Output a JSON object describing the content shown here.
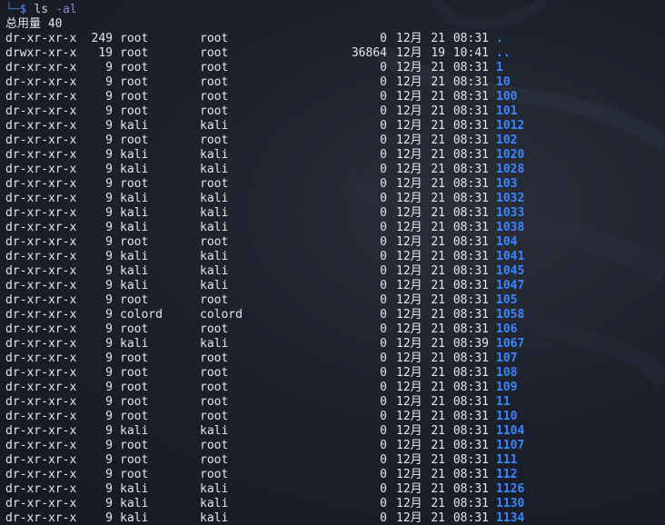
{
  "prompt": {
    "corner": "└─",
    "dollar": "$",
    "command": "ls",
    "argument": "-al"
  },
  "total_line": "总用量 40",
  "entries": [
    {
      "perm": "dr-xr-xr-x",
      "links": "249",
      "owner": "root",
      "group": "root",
      "size": "0",
      "month": "12月",
      "day": "21",
      "time": "08:31",
      "name": "."
    },
    {
      "perm": "drwxr-xr-x",
      "links": "19",
      "owner": "root",
      "group": "root",
      "size": "36864",
      "month": "12月",
      "day": "19",
      "time": "10:41",
      "name": ".."
    },
    {
      "perm": "dr-xr-xr-x",
      "links": "9",
      "owner": "root",
      "group": "root",
      "size": "0",
      "month": "12月",
      "day": "21",
      "time": "08:31",
      "name": "1"
    },
    {
      "perm": "dr-xr-xr-x",
      "links": "9",
      "owner": "root",
      "group": "root",
      "size": "0",
      "month": "12月",
      "day": "21",
      "time": "08:31",
      "name": "10"
    },
    {
      "perm": "dr-xr-xr-x",
      "links": "9",
      "owner": "root",
      "group": "root",
      "size": "0",
      "month": "12月",
      "day": "21",
      "time": "08:31",
      "name": "100"
    },
    {
      "perm": "dr-xr-xr-x",
      "links": "9",
      "owner": "root",
      "group": "root",
      "size": "0",
      "month": "12月",
      "day": "21",
      "time": "08:31",
      "name": "101"
    },
    {
      "perm": "dr-xr-xr-x",
      "links": "9",
      "owner": "kali",
      "group": "kali",
      "size": "0",
      "month": "12月",
      "day": "21",
      "time": "08:31",
      "name": "1012"
    },
    {
      "perm": "dr-xr-xr-x",
      "links": "9",
      "owner": "root",
      "group": "root",
      "size": "0",
      "month": "12月",
      "day": "21",
      "time": "08:31",
      "name": "102"
    },
    {
      "perm": "dr-xr-xr-x",
      "links": "9",
      "owner": "kali",
      "group": "kali",
      "size": "0",
      "month": "12月",
      "day": "21",
      "time": "08:31",
      "name": "1020"
    },
    {
      "perm": "dr-xr-xr-x",
      "links": "9",
      "owner": "kali",
      "group": "kali",
      "size": "0",
      "month": "12月",
      "day": "21",
      "time": "08:31",
      "name": "1028"
    },
    {
      "perm": "dr-xr-xr-x",
      "links": "9",
      "owner": "root",
      "group": "root",
      "size": "0",
      "month": "12月",
      "day": "21",
      "time": "08:31",
      "name": "103"
    },
    {
      "perm": "dr-xr-xr-x",
      "links": "9",
      "owner": "kali",
      "group": "kali",
      "size": "0",
      "month": "12月",
      "day": "21",
      "time": "08:31",
      "name": "1032"
    },
    {
      "perm": "dr-xr-xr-x",
      "links": "9",
      "owner": "kali",
      "group": "kali",
      "size": "0",
      "month": "12月",
      "day": "21",
      "time": "08:31",
      "name": "1033"
    },
    {
      "perm": "dr-xr-xr-x",
      "links": "9",
      "owner": "kali",
      "group": "kali",
      "size": "0",
      "month": "12月",
      "day": "21",
      "time": "08:31",
      "name": "1038"
    },
    {
      "perm": "dr-xr-xr-x",
      "links": "9",
      "owner": "root",
      "group": "root",
      "size": "0",
      "month": "12月",
      "day": "21",
      "time": "08:31",
      "name": "104"
    },
    {
      "perm": "dr-xr-xr-x",
      "links": "9",
      "owner": "kali",
      "group": "kali",
      "size": "0",
      "month": "12月",
      "day": "21",
      "time": "08:31",
      "name": "1041"
    },
    {
      "perm": "dr-xr-xr-x",
      "links": "9",
      "owner": "kali",
      "group": "kali",
      "size": "0",
      "month": "12月",
      "day": "21",
      "time": "08:31",
      "name": "1045"
    },
    {
      "perm": "dr-xr-xr-x",
      "links": "9",
      "owner": "kali",
      "group": "kali",
      "size": "0",
      "month": "12月",
      "day": "21",
      "time": "08:31",
      "name": "1047"
    },
    {
      "perm": "dr-xr-xr-x",
      "links": "9",
      "owner": "root",
      "group": "root",
      "size": "0",
      "month": "12月",
      "day": "21",
      "time": "08:31",
      "name": "105"
    },
    {
      "perm": "dr-xr-xr-x",
      "links": "9",
      "owner": "colord",
      "group": "colord",
      "size": "0",
      "month": "12月",
      "day": "21",
      "time": "08:31",
      "name": "1058"
    },
    {
      "perm": "dr-xr-xr-x",
      "links": "9",
      "owner": "root",
      "group": "root",
      "size": "0",
      "month": "12月",
      "day": "21",
      "time": "08:31",
      "name": "106"
    },
    {
      "perm": "dr-xr-xr-x",
      "links": "9",
      "owner": "kali",
      "group": "kali",
      "size": "0",
      "month": "12月",
      "day": "21",
      "time": "08:39",
      "name": "1067"
    },
    {
      "perm": "dr-xr-xr-x",
      "links": "9",
      "owner": "root",
      "group": "root",
      "size": "0",
      "month": "12月",
      "day": "21",
      "time": "08:31",
      "name": "107"
    },
    {
      "perm": "dr-xr-xr-x",
      "links": "9",
      "owner": "root",
      "group": "root",
      "size": "0",
      "month": "12月",
      "day": "21",
      "time": "08:31",
      "name": "108"
    },
    {
      "perm": "dr-xr-xr-x",
      "links": "9",
      "owner": "root",
      "group": "root",
      "size": "0",
      "month": "12月",
      "day": "21",
      "time": "08:31",
      "name": "109"
    },
    {
      "perm": "dr-xr-xr-x",
      "links": "9",
      "owner": "root",
      "group": "root",
      "size": "0",
      "month": "12月",
      "day": "21",
      "time": "08:31",
      "name": "11"
    },
    {
      "perm": "dr-xr-xr-x",
      "links": "9",
      "owner": "root",
      "group": "root",
      "size": "0",
      "month": "12月",
      "day": "21",
      "time": "08:31",
      "name": "110"
    },
    {
      "perm": "dr-xr-xr-x",
      "links": "9",
      "owner": "kali",
      "group": "kali",
      "size": "0",
      "month": "12月",
      "day": "21",
      "time": "08:31",
      "name": "1104"
    },
    {
      "perm": "dr-xr-xr-x",
      "links": "9",
      "owner": "root",
      "group": "root",
      "size": "0",
      "month": "12月",
      "day": "21",
      "time": "08:31",
      "name": "1107"
    },
    {
      "perm": "dr-xr-xr-x",
      "links": "9",
      "owner": "root",
      "group": "root",
      "size": "0",
      "month": "12月",
      "day": "21",
      "time": "08:31",
      "name": "111"
    },
    {
      "perm": "dr-xr-xr-x",
      "links": "9",
      "owner": "root",
      "group": "root",
      "size": "0",
      "month": "12月",
      "day": "21",
      "time": "08:31",
      "name": "112"
    },
    {
      "perm": "dr-xr-xr-x",
      "links": "9",
      "owner": "kali",
      "group": "kali",
      "size": "0",
      "month": "12月",
      "day": "21",
      "time": "08:31",
      "name": "1126"
    },
    {
      "perm": "dr-xr-xr-x",
      "links": "9",
      "owner": "kali",
      "group": "kali",
      "size": "0",
      "month": "12月",
      "day": "21",
      "time": "08:31",
      "name": "1130"
    },
    {
      "perm": "dr-xr-xr-x",
      "links": "9",
      "owner": "kali",
      "group": "kali",
      "size": "0",
      "month": "12月",
      "day": "21",
      "time": "08:31",
      "name": "1134"
    }
  ],
  "colors": {
    "background": "#1b1f2a",
    "text": "#e6e6e6",
    "prompt": "#3b6fd8",
    "argument": "#9a7fc8",
    "directory": "#3a86ff"
  }
}
